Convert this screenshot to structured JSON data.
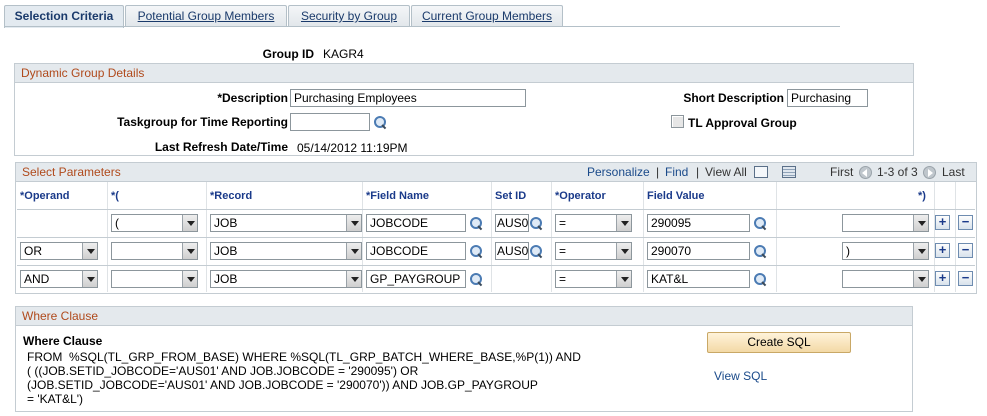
{
  "tabs": [
    {
      "label": "Selection Criteria",
      "active": true
    },
    {
      "label": "Potential Group Members",
      "active": false
    },
    {
      "label": "Security by Group",
      "active": false
    },
    {
      "label": "Current Group Members",
      "active": false
    }
  ],
  "group_id": {
    "label": "Group ID",
    "value": "KAGR4"
  },
  "dynamic_group": {
    "title": "Dynamic Group Details",
    "description_label": "*Description",
    "description_value": "Purchasing Employees",
    "short_description_label": "Short Description",
    "short_description_value": "Purchasing",
    "taskgroup_label": "Taskgroup for Time Reporting",
    "taskgroup_value": "",
    "tl_approval_label": "TL Approval Group",
    "tl_approval_checked": true,
    "last_refresh_label": "Last Refresh Date/Time",
    "last_refresh_value": "05/14/2012 11:19PM"
  },
  "select_parameters": {
    "title": "Select Parameters",
    "personalize": "Personalize",
    "find": "Find",
    "view_all": "View All",
    "first": "First",
    "range": "1-3 of 3",
    "last": "Last",
    "separator": "|",
    "columns": {
      "operand": "*Operand",
      "open_paren": "*(",
      "record": "*Record",
      "field_name": "*Field Name",
      "set_id": "Set ID",
      "operator": "*Operator",
      "field_value": "Field Value",
      "close_paren": "*)"
    },
    "rows": [
      {
        "operand": "",
        "open_paren": "(",
        "record": "JOB",
        "field_name": "JOBCODE",
        "set_id": "AUS01",
        "operator": "=",
        "field_value": "290095",
        "close_paren": ""
      },
      {
        "operand": "OR",
        "open_paren": "",
        "record": "JOB",
        "field_name": "JOBCODE",
        "set_id": "AUS01",
        "operator": "=",
        "field_value": "290070",
        "close_paren": ")"
      },
      {
        "operand": "AND",
        "open_paren": "",
        "record": "JOB",
        "field_name": "GP_PAYGROUP",
        "set_id": "",
        "operator": "=",
        "field_value": "KAT&L",
        "close_paren": ""
      }
    ],
    "add_symbol": "+",
    "remove_symbol": "−"
  },
  "where_clause": {
    "title": "Where Clause",
    "label": "Where Clause",
    "lines": [
      "FROM  %SQL(TL_GRP_FROM_BASE) WHERE %SQL(TL_GRP_BATCH_WHERE_BASE,%P(1)) AND",
      "( ((JOB.SETID_JOBCODE='AUS01' AND JOB.JOBCODE = '290095') OR",
      "(JOB.SETID_JOBCODE='AUS01' AND JOB.JOBCODE = '290070')) AND JOB.GP_PAYGROUP",
      "= 'KAT&L')"
    ],
    "create_sql": "Create SQL",
    "view_sql": "View SQL"
  }
}
